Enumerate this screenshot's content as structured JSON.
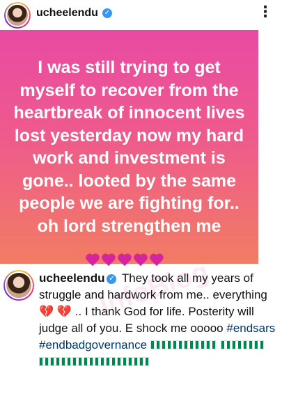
{
  "header": {
    "username": "ucheelendu",
    "verified_icon": "✓",
    "more_label": "⋮"
  },
  "post": {
    "text": "I was still trying to get myself to recover from the heartbreak of innocent lives lost yesterday now my hard work and investment is gone.. looted by the same people we are fighting for.. oh lord strengthen me",
    "hearts_count": 5,
    "background_colors": [
      "#e94aa3",
      "#ee5a8c",
      "#f27c63"
    ]
  },
  "caption": {
    "username": "ucheelendu",
    "verified_icon": "✓",
    "text_part1": "They took all my years of struggle and hardwork from me.. everything",
    "text_part2": ".. I thank God for life. Posterity will judge all of you. E shock me ooooo",
    "hashtag1": "#endsars",
    "hashtag2": "#endbadgovernance",
    "broken_hearts": "💔 💔",
    "flags_row1": 6,
    "flags_row2": 14
  },
  "watermark": "InfoBlog",
  "colors": {
    "verified": "#3897f0",
    "hashtag": "#00376b",
    "heart": "#d6249f"
  }
}
